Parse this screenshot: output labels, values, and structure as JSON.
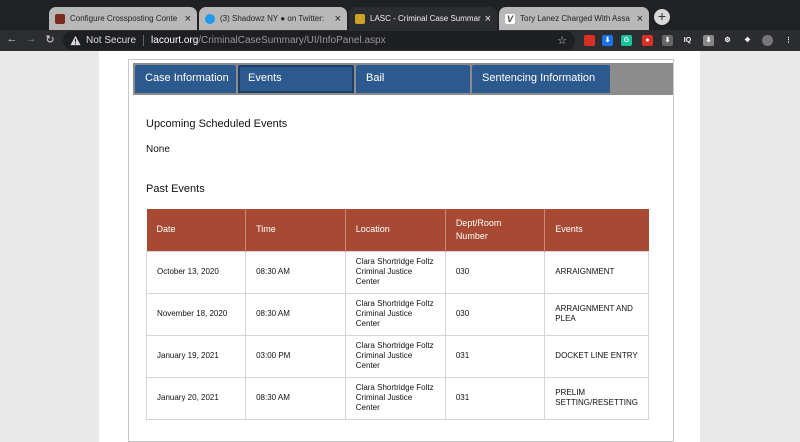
{
  "browser": {
    "tabs": [
      {
        "title": "Configure Crossposting Conte",
        "favicon_color": "#7a2a1e"
      },
      {
        "title": "(3) Shadowz NY ● on Twitter:",
        "favicon_color": "#1d9bf0"
      },
      {
        "title": "LASC - Criminal Case Summar",
        "favicon_color": "#c9a227"
      },
      {
        "title": "Tory Lanez Charged With Assa",
        "favicon_color": "#444444"
      }
    ],
    "close_glyph": "×",
    "new_tab_glyph": "+",
    "nav": {
      "back": "←",
      "forward": "→",
      "reload": "↻"
    },
    "address": {
      "security_label": "Not Secure",
      "host": "lacourt.org",
      "path": "/CriminalCaseSummary/UI/InfoPanel.aspx"
    },
    "extensions": [
      {
        "name": "ext-red",
        "color": "#d93025",
        "label": ""
      },
      {
        "name": "ext-download",
        "color": "#1a73e8",
        "label": "⬇"
      },
      {
        "name": "ext-grammarly",
        "color": "#15c39a",
        "label": "G"
      },
      {
        "name": "ext-record",
        "color": "#d93025",
        "label": "●"
      },
      {
        "name": "ext-arrow",
        "color": "#666666",
        "label": "⬇"
      },
      {
        "name": "ext-iq",
        "color": "#2c2d30",
        "label": "IQ"
      },
      {
        "name": "ext-save",
        "color": "#888888",
        "label": "⬇"
      },
      {
        "name": "ext-gear",
        "color": "#2c2d30",
        "label": "⚙"
      },
      {
        "name": "ext-puzzle",
        "color": "#2c2d30",
        "label": "❖"
      },
      {
        "name": "ext-avatar",
        "color": "#777777",
        "label": ""
      },
      {
        "name": "ext-menu",
        "color": "#2c2d30",
        "label": "⋮"
      }
    ]
  },
  "panel_tabs": [
    {
      "label": "Case Information"
    },
    {
      "label": "Events"
    },
    {
      "label": "Bail"
    },
    {
      "label": "Sentencing Information"
    }
  ],
  "upcoming": {
    "title": "Upcoming Scheduled Events",
    "value": "None"
  },
  "past": {
    "title": "Past Events",
    "columns": [
      "Date",
      "Time",
      "Location",
      "Dept/Room Number",
      "Events"
    ],
    "rows": [
      [
        "October 13, 2020",
        "08:30 AM",
        "Clara Shortridge Foltz Criminal Justice Center",
        "030",
        "ARRAIGNMENT"
      ],
      [
        "November 18, 2020",
        "08:30 AM",
        "Clara Shortridge Foltz Criminal Justice Center",
        "030",
        "ARRAIGNMENT AND PLEA"
      ],
      [
        "January 19, 2021",
        "03:00 PM",
        "Clara Shortridge Foltz Criminal Justice Center",
        "031",
        "DOCKET LINE ENTRY"
      ],
      [
        "January 20, 2021",
        "08:30 AM",
        "Clara Shortridge Foltz Criminal Justice Center",
        "031",
        "PRELIM SETTING/RESETTING"
      ]
    ]
  }
}
